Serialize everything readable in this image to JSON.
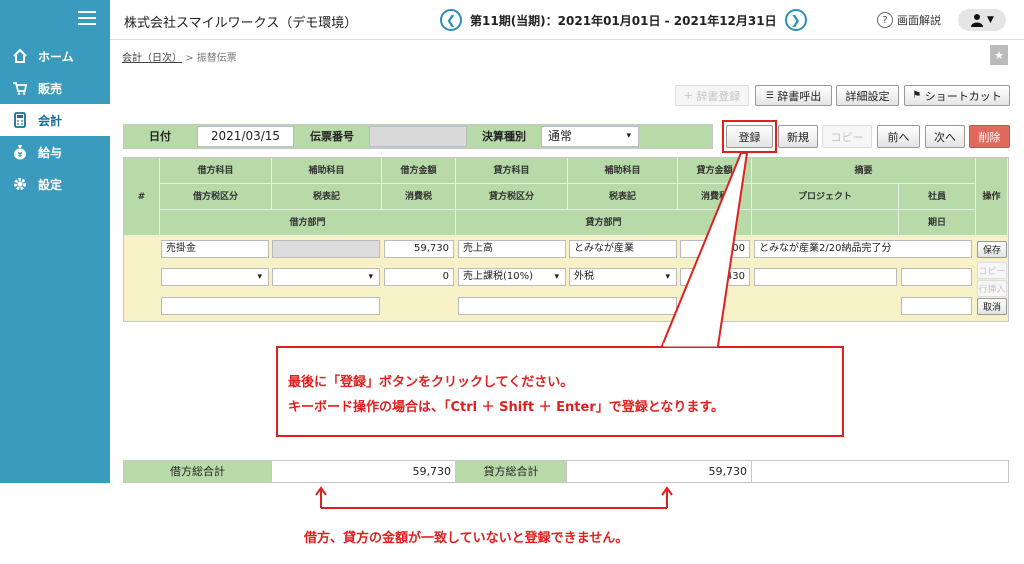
{
  "sidebar": {
    "items": [
      {
        "label": "ホーム",
        "icon": "home-icon"
      },
      {
        "label": "販売",
        "icon": "cart-icon"
      },
      {
        "label": "会計",
        "icon": "calculator-icon"
      },
      {
        "label": "給与",
        "icon": "money-bag-icon"
      },
      {
        "label": "設定",
        "icon": "gear-icon"
      }
    ],
    "active": "会計"
  },
  "header": {
    "company": "株式会社スマイルワークス（デモ環境）",
    "period": "第11期(当期)：2021年01月01日 - 2021年12月31日",
    "help_label": "画面解説"
  },
  "breadcrumb": {
    "link": "会計（日次）",
    "separator": ">",
    "current": "振替伝票"
  },
  "toolbar": {
    "register_dict": "辞書登録",
    "call_dict": "辞書呼出",
    "detail_settings": "詳細設定",
    "shortcut": "ショートカット"
  },
  "entry": {
    "date_label": "日付",
    "date_value": "2021/03/15",
    "slip_no_label": "伝票番号",
    "slip_no_value": "",
    "settlement_label": "決算種別",
    "settlement_value": "通常"
  },
  "actions": {
    "register": "登録",
    "new": "新規",
    "copy": "コピー",
    "prev": "前へ",
    "next": "次へ",
    "delete": "削除"
  },
  "grid_headers": {
    "num": "#",
    "debit_account": "借方科目",
    "debit_sub": "補助科目",
    "debit_amount": "借方金額",
    "credit_account": "貸方科目",
    "credit_sub": "補助科目",
    "credit_amount": "貸方金額",
    "summary": "摘要",
    "debit_tax_class": "借方税区分",
    "debit_tax_note": "税表記",
    "debit_tax": "消費税",
    "credit_tax_class": "貸方税区分",
    "credit_tax_note": "税表記",
    "credit_tax": "消費税",
    "project": "プロジェクト",
    "employee": "社員",
    "operation": "操作",
    "debit_dept": "借方部門",
    "credit_dept": "貸方部門",
    "due_date": "期日"
  },
  "row": {
    "debit_account": "売掛金",
    "debit_amount": "59,730",
    "debit_tax": "0",
    "credit_account": "売上高",
    "credit_sub": "とみなが産業",
    "credit_amount_visible": "00",
    "credit_tax_class": "売上課税(10%)",
    "credit_tax_note": "外税",
    "credit_tax_visible": "430",
    "summary": "とみなが産業2/20納品完了分"
  },
  "row_buttons": {
    "save": "保存",
    "copy": "コピー",
    "insert": "行挿入",
    "cancel": "取消"
  },
  "callout": {
    "line1": "最後に「登録」ボタンをクリックしてください。",
    "line2": "キーボード操作の場合は、「Ctrl ＋ Shift ＋ Enter」で登録となります。"
  },
  "totals": {
    "debit_label": "借方総合計",
    "debit_value": "59,730",
    "credit_label": "貸方総合計",
    "credit_value": "59,730"
  },
  "bottom_note": "借方、貸方の金額が一致していないと登録できません。",
  "colors": {
    "sidebar": "#3a9bbf",
    "header_green": "#b8d9a8",
    "row_yellow": "#f7f1c7",
    "accent_red": "#e02020"
  }
}
